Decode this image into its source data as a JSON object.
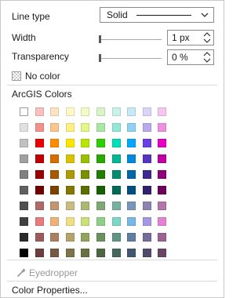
{
  "line_type": {
    "label": "Line type",
    "value": "Solid"
  },
  "width": {
    "label": "Width",
    "value": "1 px"
  },
  "transparency": {
    "label": "Transparency",
    "value": "0 %"
  },
  "no_color": {
    "label": "No color"
  },
  "palette": {
    "title": "ArcGIS Colors",
    "columns": 10,
    "rows": [
      [
        "#ffffff",
        "#fbc0bc",
        "#fde3c3",
        "#fff9c6",
        "#f1fbc6",
        "#d9f5c8",
        "#c9f3e8",
        "#c6e8f7",
        "#dcd4f7",
        "#f5c6ee"
      ],
      [
        "#e0e0e0",
        "#f59089",
        "#fbc68c",
        "#fff17f",
        "#e3f686",
        "#a9e8a4",
        "#93e8d8",
        "#8ed1f4",
        "#b9a9ef",
        "#ee90df"
      ],
      [
        "#c0c0c0",
        "#ec0000",
        "#ff8c00",
        "#ffe500",
        "#b9e600",
        "#2ecf00",
        "#00dfb5",
        "#00a8ff",
        "#6a3fe6",
        "#e600c4"
      ],
      [
        "#a0a0a0",
        "#c00000",
        "#d46f00",
        "#d9c200",
        "#98bf00",
        "#28a800",
        "#00b891",
        "#008ad9",
        "#5634bf",
        "#bf00a2"
      ],
      [
        "#808080",
        "#9a0000",
        "#a85800",
        "#ad9a00",
        "#798f00",
        "#207e00",
        "#008c6e",
        "#0067a6",
        "#40268f",
        "#8f0079"
      ],
      [
        "#606060",
        "#720000",
        "#7d4200",
        "#857700",
        "#5c6e00",
        "#175f00",
        "#006b55",
        "#004f80",
        "#30206e",
        "#6d005c"
      ],
      [
        "#505050",
        "#b06a6a",
        "#bf9573",
        "#c9bb82",
        "#aab873",
        "#7fa874",
        "#78b0a0",
        "#7796ba",
        "#8d83b3",
        "#b378a9"
      ],
      [
        "#404040",
        "#e87b7b",
        "#f0b07a",
        "#f0de84",
        "#c9e07a",
        "#8fd088",
        "#7ed6c4",
        "#79b8e6",
        "#a796e3",
        "#e482d2"
      ],
      [
        "#2a2a2a",
        "#9e5a5a",
        "#a98162",
        "#b3a46a",
        "#93a35f",
        "#6a925e",
        "#5f9585",
        "#5f7ea1",
        "#766c9b",
        "#9c6291"
      ],
      [
        "#000000",
        "#6e3d3d",
        "#765845",
        "#7e7348",
        "#677142",
        "#4a6642",
        "#43685d",
        "#435870",
        "#524b6c",
        "#6c4465"
      ]
    ]
  },
  "eyedropper": {
    "label": "Eyedropper"
  },
  "color_properties": {
    "label": "Color Properties..."
  }
}
